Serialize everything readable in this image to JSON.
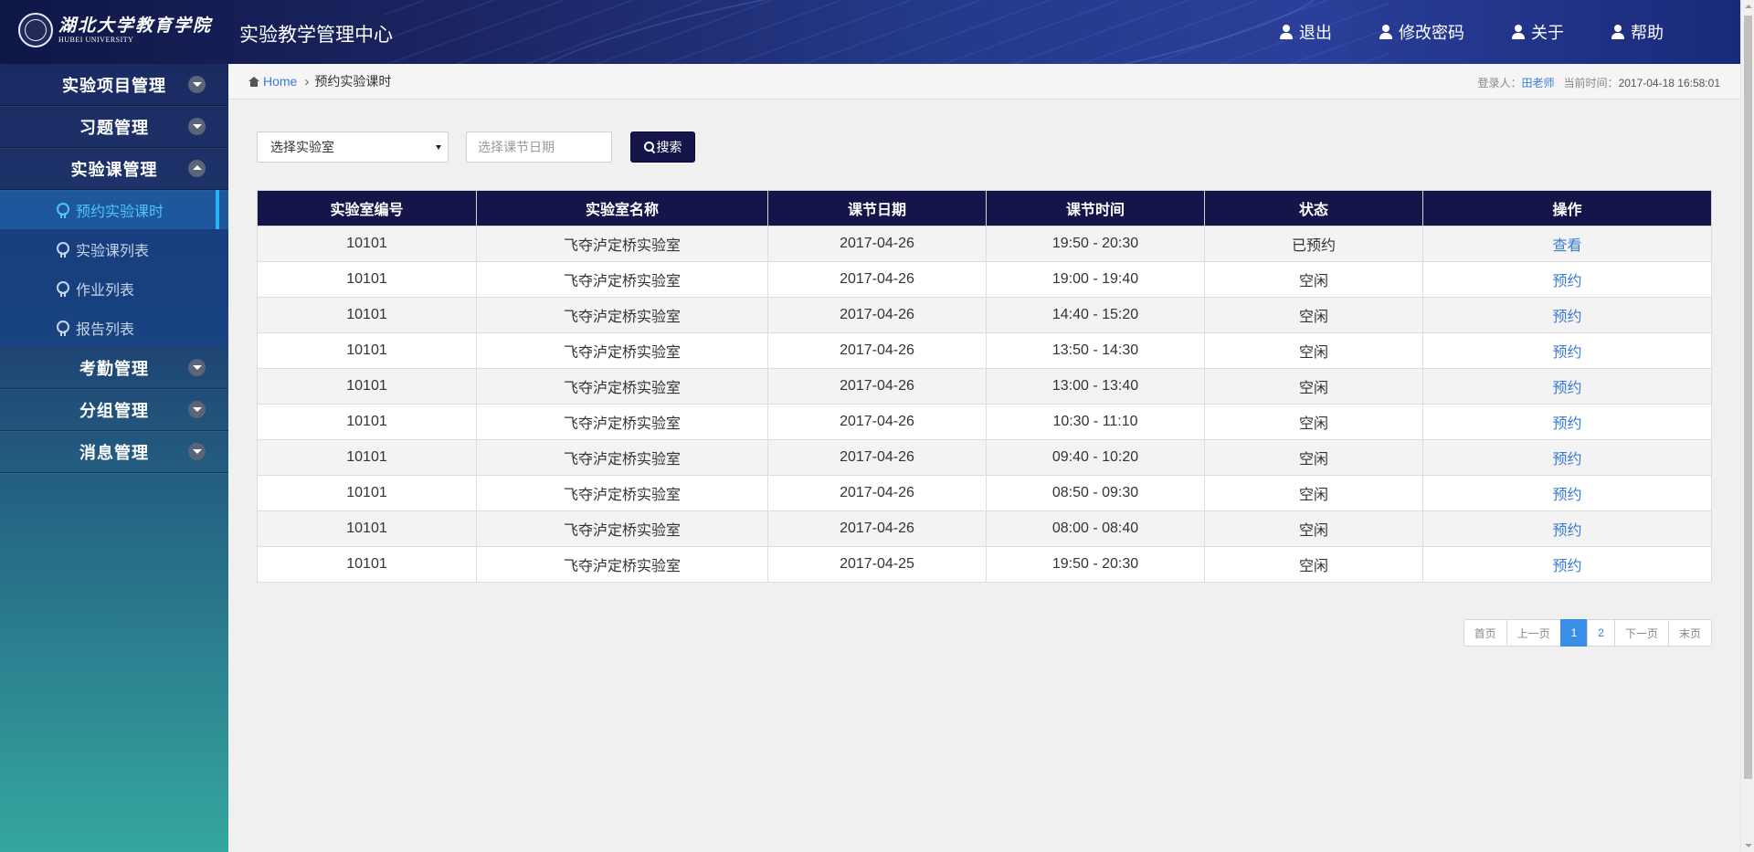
{
  "header": {
    "logo_cn": "湖北大学教育学院",
    "logo_en": "HUBEI UNIVERSITY",
    "app_title": "实验教学管理中心",
    "nav": [
      {
        "label": "退出",
        "icon": "user-icon"
      },
      {
        "label": "修改密码",
        "icon": "user-icon"
      },
      {
        "label": "关于",
        "icon": "user-icon"
      },
      {
        "label": "帮助",
        "icon": "user-icon"
      }
    ]
  },
  "sidebar": {
    "groups": [
      {
        "label": "实验项目管理",
        "expanded": false
      },
      {
        "label": "习题管理",
        "expanded": false
      },
      {
        "label": "实验课管理",
        "expanded": true,
        "items": [
          {
            "label": "预约实验课时",
            "active": true
          },
          {
            "label": "实验课列表",
            "active": false
          },
          {
            "label": "作业列表",
            "active": false
          },
          {
            "label": "报告列表",
            "active": false
          }
        ]
      },
      {
        "label": "考勤管理",
        "expanded": false
      },
      {
        "label": "分组管理",
        "expanded": false
      },
      {
        "label": "消息管理",
        "expanded": false
      }
    ]
  },
  "breadcrumb": {
    "home": "Home",
    "current": "预约实验课时"
  },
  "login_info": {
    "user_label": "登录人：",
    "user": "田老师",
    "time_label": "当前时间：",
    "time": "2017-04-18 16:58:01"
  },
  "toolbar": {
    "lab_select_value": "选择实验室",
    "date_placeholder": "选择课节日期",
    "search_label": "搜索"
  },
  "table": {
    "headers": [
      "实验室编号",
      "实验室名称",
      "课节日期",
      "课节时间",
      "状态",
      "操作"
    ],
    "rows": [
      [
        "10101",
        "飞夺泸定桥实验室",
        "2017-04-26",
        "19:50 - 20:30",
        "已预约",
        "查看"
      ],
      [
        "10101",
        "飞夺泸定桥实验室",
        "2017-04-26",
        "19:00 - 19:40",
        "空闲",
        "预约"
      ],
      [
        "10101",
        "飞夺泸定桥实验室",
        "2017-04-26",
        "14:40 - 15:20",
        "空闲",
        "预约"
      ],
      [
        "10101",
        "飞夺泸定桥实验室",
        "2017-04-26",
        "13:50 - 14:30",
        "空闲",
        "预约"
      ],
      [
        "10101",
        "飞夺泸定桥实验室",
        "2017-04-26",
        "13:00 - 13:40",
        "空闲",
        "预约"
      ],
      [
        "10101",
        "飞夺泸定桥实验室",
        "2017-04-26",
        "10:30 - 11:10",
        "空闲",
        "预约"
      ],
      [
        "10101",
        "飞夺泸定桥实验室",
        "2017-04-26",
        "09:40 - 10:20",
        "空闲",
        "预约"
      ],
      [
        "10101",
        "飞夺泸定桥实验室",
        "2017-04-26",
        "08:50 - 09:30",
        "空闲",
        "预约"
      ],
      [
        "10101",
        "飞夺泸定桥实验室",
        "2017-04-26",
        "08:00 - 08:40",
        "空闲",
        "预约"
      ],
      [
        "10101",
        "飞夺泸定桥实验室",
        "2017-04-25",
        "19:50 - 20:30",
        "空闲",
        "预约"
      ]
    ]
  },
  "pagination": {
    "first": "首页",
    "prev": "上一页",
    "pages": [
      "1",
      "2"
    ],
    "current": "1",
    "next": "下一页",
    "last": "末页"
  },
  "colors": {
    "header_bg": "#1b2460",
    "table_header": "#151549",
    "link": "#3a7bd5",
    "active_page": "#3a8ee6",
    "active_menu_accent": "#21b7f5"
  }
}
